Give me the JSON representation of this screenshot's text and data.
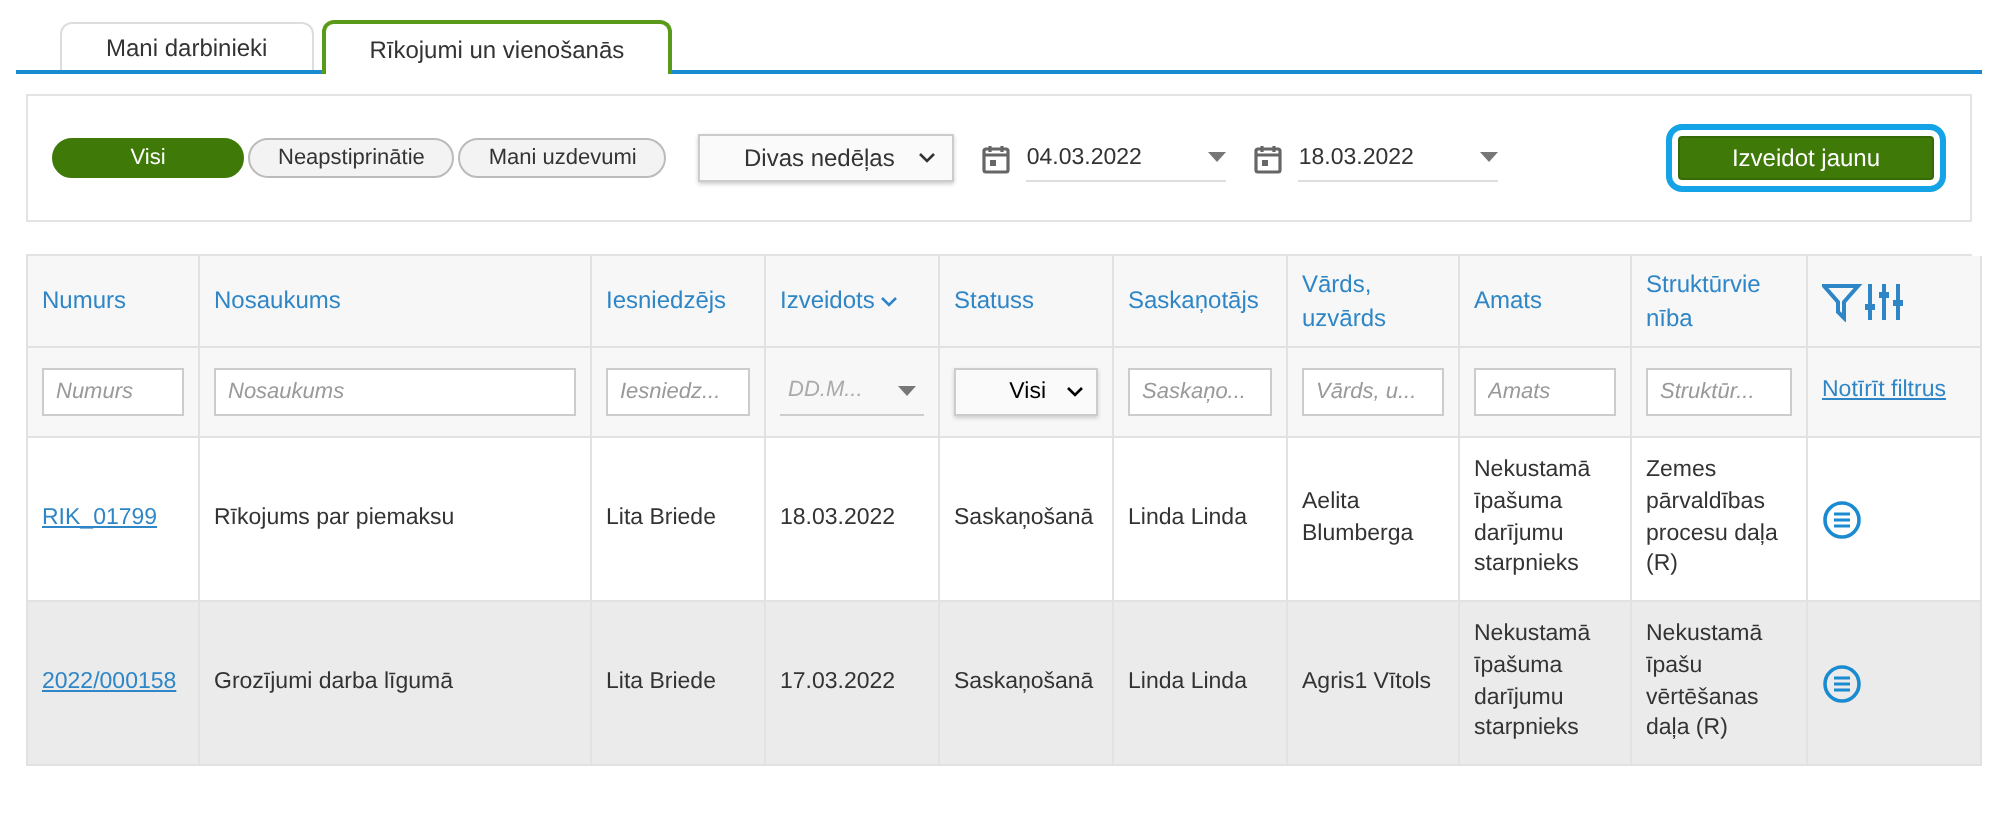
{
  "tabs": [
    {
      "label": "Mani darbinieki",
      "selected": false
    },
    {
      "label": "Rīkojumi un vienošanās",
      "selected": true
    }
  ],
  "toolbar": {
    "filters": [
      {
        "label": "Visi",
        "selected": true
      },
      {
        "label": "Neapstiprinātie",
        "selected": false
      },
      {
        "label": "Mani uzdevumi",
        "selected": false
      }
    ],
    "period": "Divas nedēļas",
    "date_from": "04.03.2022",
    "date_to": "18.03.2022",
    "create_button": "Izveidot jaunu"
  },
  "table": {
    "columns": [
      {
        "label": "Numurs",
        "sorted": false
      },
      {
        "label": "Nosaukums",
        "sorted": false
      },
      {
        "label": "Iesniedzējs",
        "sorted": false
      },
      {
        "label": "Izveidots",
        "sorted": true
      },
      {
        "label": "Statuss",
        "sorted": false
      },
      {
        "label": "Saskaņotājs",
        "sorted": false
      },
      {
        "label": "Vārds, uzvārds",
        "sorted": false
      },
      {
        "label": "Amats",
        "sorted": false
      },
      {
        "label": "Struktūrvienība",
        "sorted": false
      }
    ],
    "filters": [
      {
        "kind": "text",
        "placeholder": "Numurs"
      },
      {
        "kind": "text",
        "placeholder": "Nosaukums"
      },
      {
        "kind": "text",
        "placeholder": "Iesniedz..."
      },
      {
        "kind": "date",
        "placeholder": "DD.M..."
      },
      {
        "kind": "select",
        "value": "Visi"
      },
      {
        "kind": "text",
        "placeholder": "Saskaņo..."
      },
      {
        "kind": "text",
        "placeholder": "Vārds, u..."
      },
      {
        "kind": "text",
        "placeholder": "Amats"
      },
      {
        "kind": "text",
        "placeholder": "Struktūr..."
      }
    ],
    "clear_filters": "Notīrīt filtrus",
    "rows": [
      {
        "selected": false,
        "cells": [
          "RIK_01799",
          "Rīkojums par piemaksu",
          "Lita Briede",
          "18.03.2022",
          "Saskaņošanā",
          "Linda Linda",
          "Aelita Blumberga",
          "Nekustamā īpašuma darījumu starpnieks",
          "Zemes pārvaldības procesu daļa (R)"
        ]
      },
      {
        "selected": true,
        "cells": [
          "2022/000158",
          "Grozījumi darba līgumā",
          "Lita Briede",
          "17.03.2022",
          "Saskaņošanā",
          "Linda Linda",
          "Agris1 Vītols",
          "Nekustamā īpašuma darījumu starpnieks",
          "Nekustamā īpašu vērtēšanas daļa (R)"
        ]
      }
    ]
  }
}
